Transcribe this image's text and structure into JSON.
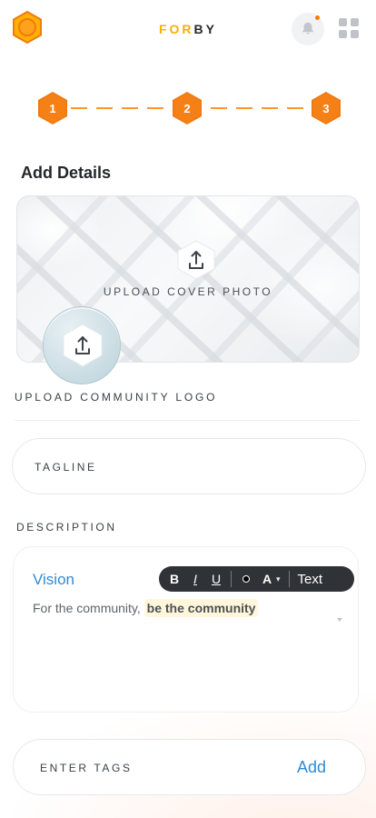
{
  "header": {
    "brand_a": "FOR",
    "brand_b": "BY",
    "icons": {
      "logo": "hexagon-logo-icon",
      "notifications": "bell-icon",
      "apps": "apps-grid-icon"
    },
    "colors": {
      "accent": "#f07a12",
      "brand_yellow": "#f5b000"
    }
  },
  "stepper": {
    "steps": [
      {
        "label": "1"
      },
      {
        "label": "2"
      },
      {
        "label": "3"
      }
    ]
  },
  "page": {
    "title": "Add Details"
  },
  "cover": {
    "upload_label": "UPLOAD COVER PHOTO",
    "icon": "upload-icon"
  },
  "community_logo": {
    "upload_label": "UPLOAD COMMUNITY LOGO",
    "icon": "upload-icon"
  },
  "fields": {
    "tagline_placeholder": "TAGLINE",
    "description_label": "DESCRIPTION",
    "tags_placeholder": "ENTER TAGS",
    "tags_add": "Add"
  },
  "description": {
    "heading": "Vision",
    "text_prefix": "For the community, ",
    "text_highlight": "be the community",
    "toolbar": {
      "bold": "B",
      "italic": "I",
      "underline": "U",
      "font_color_icon": "text-color-icon",
      "font": "A",
      "text_style": "Text"
    }
  }
}
